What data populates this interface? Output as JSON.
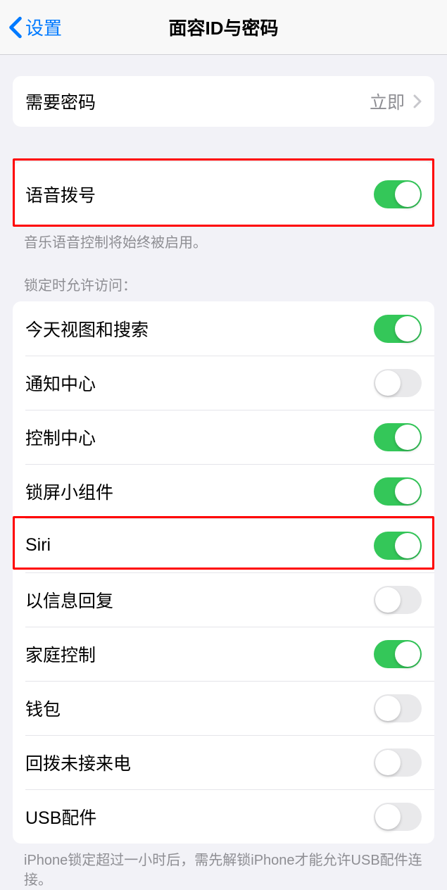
{
  "nav": {
    "back_label": "设置",
    "title": "面容ID与密码"
  },
  "require_passcode": {
    "label": "需要密码",
    "value": "立即"
  },
  "voice_dial": {
    "label": "语音拨号",
    "on": true,
    "footer": "音乐语音控制将始终被启用。"
  },
  "lock_access": {
    "header": "锁定时允许访问：",
    "items": [
      {
        "label": "今天视图和搜索",
        "on": true
      },
      {
        "label": "通知中心",
        "on": false
      },
      {
        "label": "控制中心",
        "on": true
      },
      {
        "label": "锁屏小组件",
        "on": true
      },
      {
        "label": "Siri",
        "on": true
      },
      {
        "label": "以信息回复",
        "on": false
      },
      {
        "label": "家庭控制",
        "on": true
      },
      {
        "label": "钱包",
        "on": false
      },
      {
        "label": "回拨未接来电",
        "on": false
      },
      {
        "label": "USB配件",
        "on": false
      }
    ],
    "footer": "iPhone锁定超过一小时后，需先解锁iPhone才能允许USB配件连接。"
  }
}
